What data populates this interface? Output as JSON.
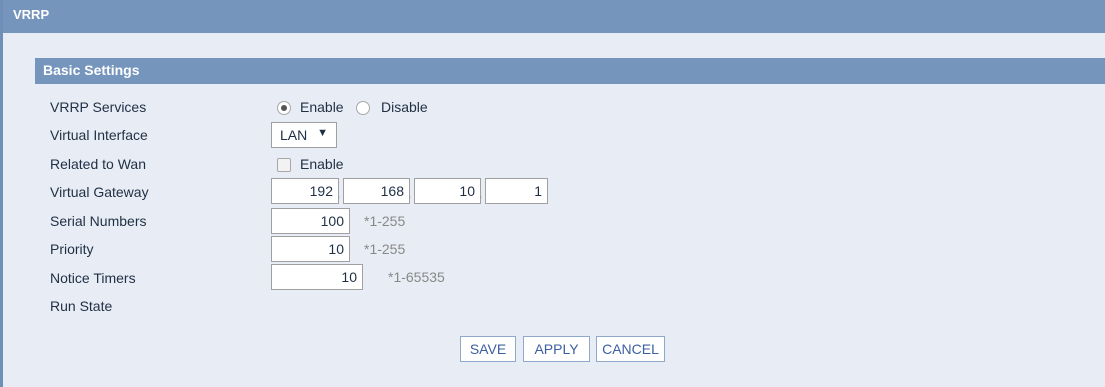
{
  "window": {
    "title": "VRRP"
  },
  "section": {
    "title": "Basic Settings"
  },
  "form": {
    "vrrp_services": {
      "label": "VRRP Services",
      "options": [
        "Enable",
        "Disable"
      ],
      "selected": "Enable"
    },
    "virtual_interface": {
      "label": "Virtual Interface",
      "value": "LAN"
    },
    "related_to_wan": {
      "label": "Related to Wan",
      "checkbox_label": "Enable",
      "checked": false
    },
    "virtual_gateway": {
      "label": "Virtual Gateway",
      "octets": [
        "192",
        "168",
        "10",
        "1"
      ]
    },
    "serial_numbers": {
      "label": "Serial Numbers",
      "value": "100",
      "hint": "*1-255"
    },
    "priority": {
      "label": "Priority",
      "value": "10",
      "hint": "*1-255"
    },
    "notice_timers": {
      "label": "Notice Timers",
      "value": "10",
      "hint": "*1-65535"
    },
    "run_state": {
      "label": "Run State",
      "value": ""
    }
  },
  "buttons": {
    "save": "SAVE",
    "apply": "APPLY",
    "cancel": "CANCEL"
  },
  "colors": {
    "header": "#7595bd",
    "background": "#e8edf5",
    "button_text": "#3b5fa0"
  }
}
